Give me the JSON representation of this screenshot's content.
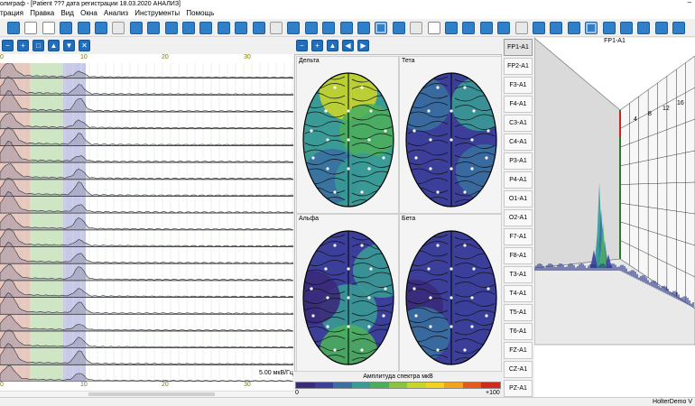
{
  "window": {
    "title": "олиграф - [Patient  ??? дата регистрации 18.03.2020  АНАЛИЗ]",
    "minimize_glyph": "–"
  },
  "menu": [
    "трация",
    "Правка",
    "Вид",
    "Окна",
    "Анализ",
    "Инструменты",
    "Помощь"
  ],
  "toolbar": {
    "icons": [
      "grid-icon",
      "save-icon",
      "print-icon",
      "open-icon",
      "calendar-icon",
      "copy-icon",
      "mail-icon",
      "settings-icon",
      "filter-icon",
      "export-icon",
      "chart-icon",
      "camera-icon",
      "image-icon",
      "comment-icon",
      "chat-icon",
      "stop-icon",
      "play-icon",
      "forward-icon",
      "wave-icon",
      "map-icon",
      "wave2-icon",
      "brain-icon",
      "leaf-icon",
      "grid2-icon",
      "page-icon",
      "list-icon",
      "target-icon",
      "user-icon",
      "tree-icon",
      "cube-icon",
      "check-icon",
      "table-icon",
      "monitor-icon",
      "split-icon",
      "zoom-icon",
      "layers-icon",
      "panel-icon",
      "topo-icon",
      "export2-icon"
    ]
  },
  "spectra_panel": {
    "tool_icons": [
      "zoom-out-icon",
      "zoom-in-icon",
      "zoom-fit-icon",
      "arrow-up-icon",
      "arrow-down-icon",
      "wrench-icon"
    ],
    "axis_top": [
      "0",
      "10",
      "20",
      "30"
    ],
    "axis_bottom": [
      "0",
      "10",
      "20",
      "30"
    ],
    "scale_label": "5.00 мкВ/Гц",
    "bands_color": {
      "delta": "#e8c7bf",
      "theta": "#cfe6c4",
      "alpha": "#c8c8e8"
    },
    "row_count": 19
  },
  "maps_panel": {
    "tool_icons": [
      "zoom-out-icon",
      "zoom-in-icon",
      "arrow-up-icon",
      "arrow-left-icon",
      "arrow-right-icon"
    ],
    "maps": [
      {
        "label": "Дельта"
      },
      {
        "label": "Тета"
      },
      {
        "label": "Альфа"
      },
      {
        "label": "Бета"
      }
    ],
    "legend_title": "Амплитуда спектра мкВ",
    "legend_min": "0",
    "legend_max": "+100",
    "legend_colors": [
      "#3b2a7a",
      "#3b3f9a",
      "#3a6fa0",
      "#3a9a96",
      "#4cae5c",
      "#8bc43c",
      "#c8d52a",
      "#f2d21f",
      "#f2a51a",
      "#e45a1c",
      "#cf2a1a"
    ]
  },
  "channels": [
    "FP1-A1",
    "FP2-A1",
    "F3-A1",
    "F4-A1",
    "C3-A1",
    "C4-A1",
    "P3-A1",
    "P4-A1",
    "O1-A1",
    "O2-A1",
    "F7-A1",
    "F8-A1",
    "T3-A1",
    "T4-A1",
    "T5-A1",
    "T6-A1",
    "FZ-A1",
    "CZ-A1",
    "PZ-A1"
  ],
  "active_channel": "FP1-A1",
  "plot3d": {
    "title": "FP1-A1",
    "ticks": [
      "4",
      "8",
      "12",
      "16"
    ]
  },
  "status": {
    "right": "HolterDemo V"
  }
}
